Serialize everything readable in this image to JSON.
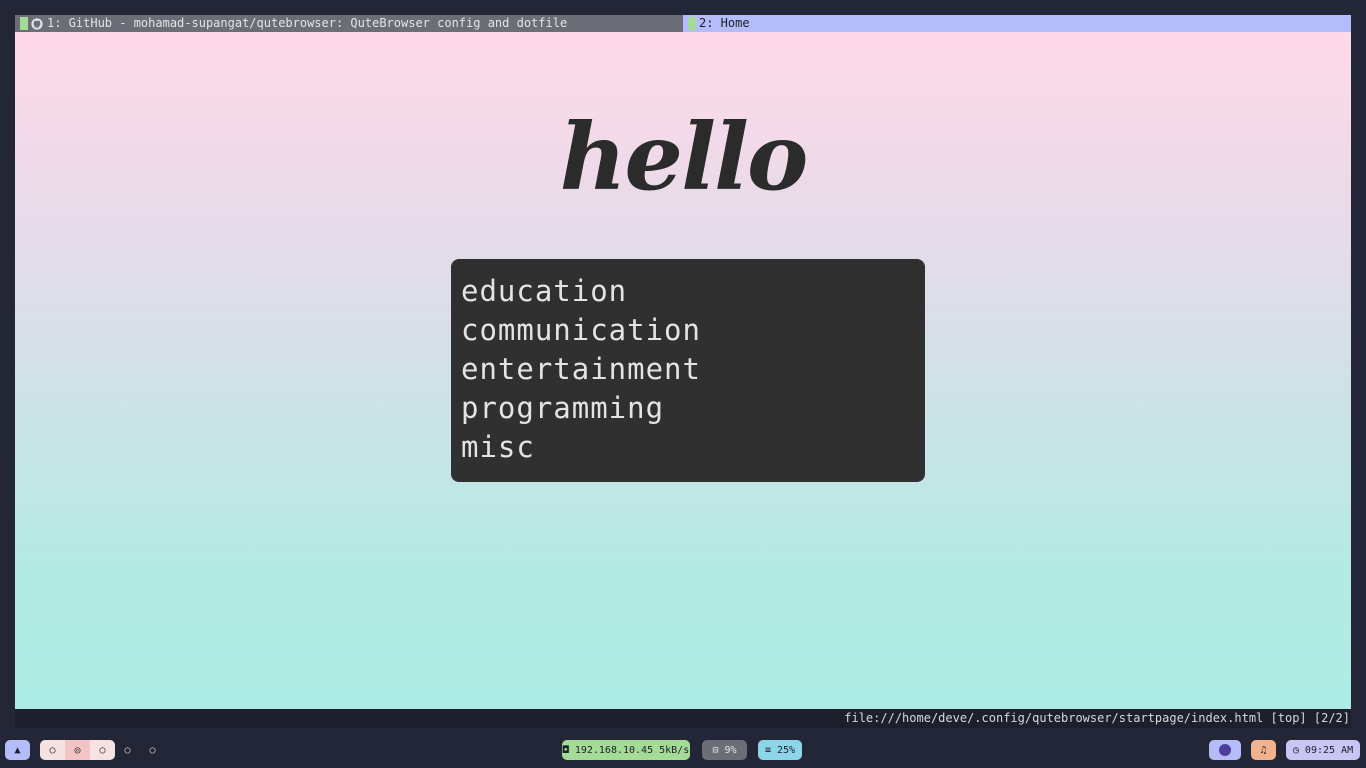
{
  "tabs": [
    {
      "label": "1: GitHub - mohamad-supangat/qutebrowser: QuteBrowser config and dotfile",
      "icon": "github-icon"
    },
    {
      "label": "2: Home"
    }
  ],
  "page": {
    "heading": "hello",
    "menu": [
      "education",
      "communication",
      "entertainment",
      "programming",
      "misc"
    ]
  },
  "statusbar": {
    "url": "file:///home/deve/.config/qutebrowser/startpage/index.html",
    "position": "[top]",
    "tab_index": "[2/2]"
  },
  "panel": {
    "launcher_glyph": "▲",
    "workspaces": [
      "○",
      "◎",
      "○",
      "○",
      "○"
    ],
    "network": "◘ 192.168.10.45 5kB/s",
    "cpu": "⊟ 9%",
    "memory": "≡ 25%",
    "bell_glyph": "♫",
    "clock": "◷ 09:25 AM"
  },
  "colors": {
    "active_tab": "#b4bcf9",
    "inactive_tab": "#6b6e77",
    "menu_bg": "#303030",
    "network_pill": "#a4dc97",
    "memory_pill": "#8dd5e9",
    "bell_pill": "#f2b28e"
  }
}
